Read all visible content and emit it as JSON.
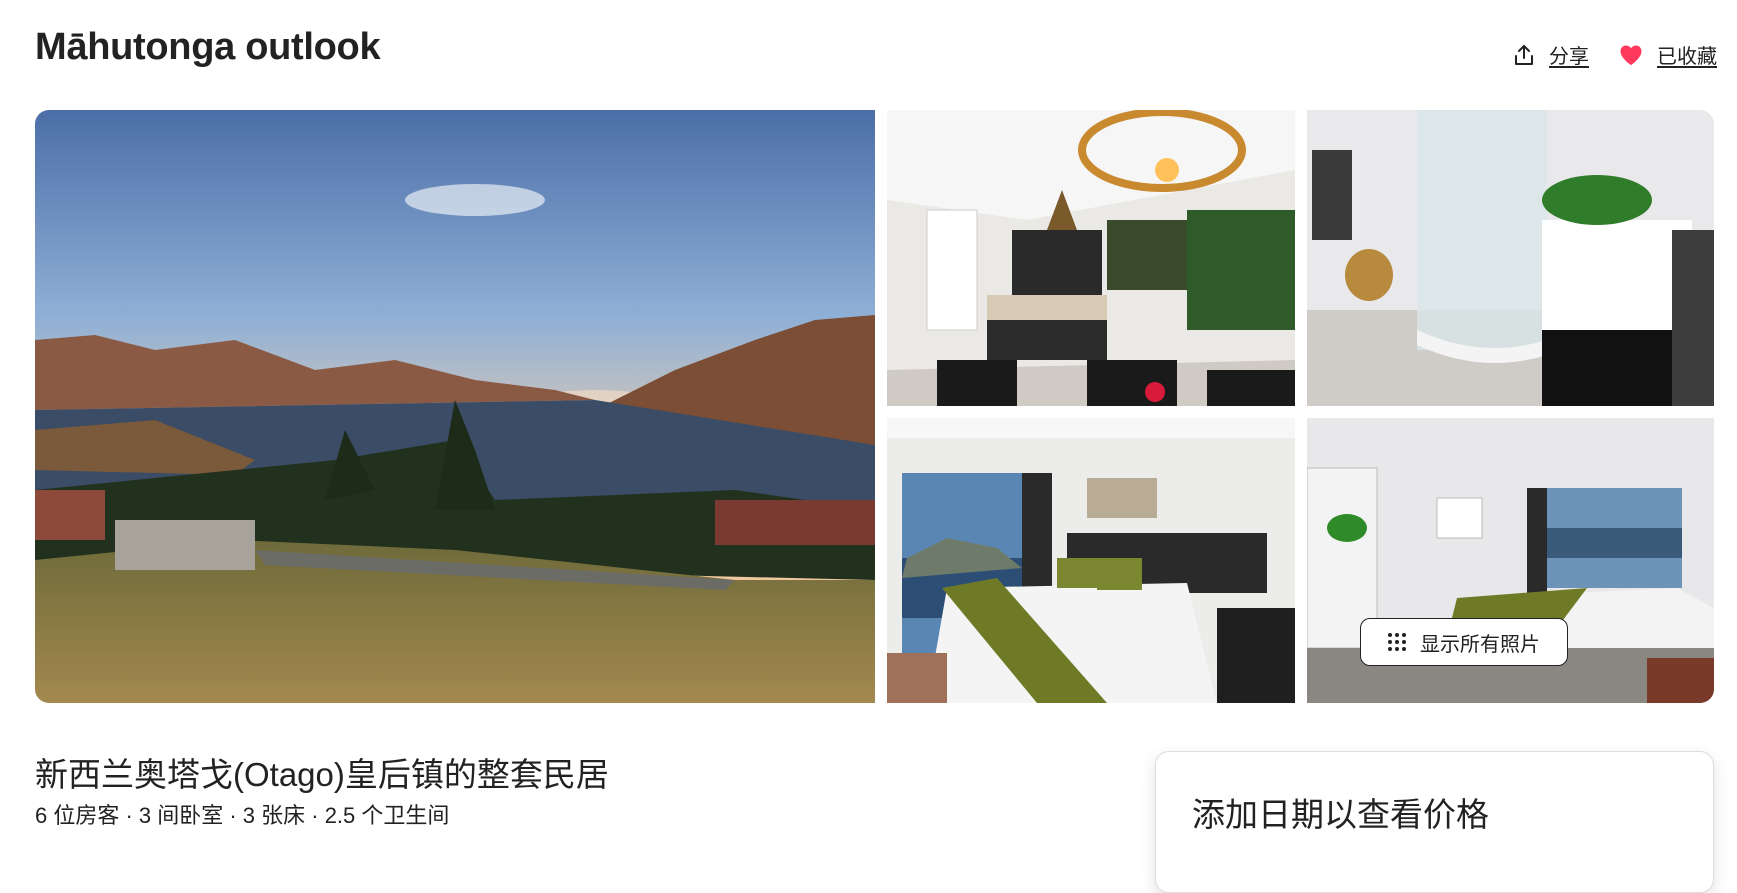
{
  "listing": {
    "title": "Māhutonga outlook",
    "subtitle": "新西兰奥塔戈(Otago)皇后镇的整套民居",
    "details": "6 位房客 · 3 间卧室 · 3 张床 · 2.5 个卫生间"
  },
  "actions": {
    "share_label": "分享",
    "share_icon": "share-icon",
    "saved_label": "已收藏",
    "saved_icon": "heart-icon",
    "saved_color": "#ff385c"
  },
  "gallery": {
    "show_all_label": "显示所有照片",
    "show_all_icon": "grid-dots-icon",
    "photos": [
      "lake-view",
      "kitchen",
      "bathroom",
      "bedroom-1",
      "bedroom-2"
    ]
  },
  "booking": {
    "title": "添加日期以查看价格"
  }
}
